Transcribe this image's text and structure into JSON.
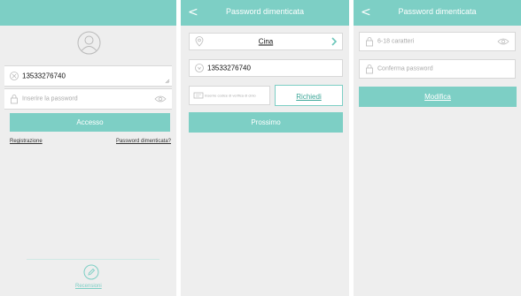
{
  "panel1": {
    "phone_value": "13533276740",
    "password_placeholder": "Inserire la password",
    "login_label": "Accesso",
    "register_label": "Registrazione",
    "forgot_label": "Password dimenticata?",
    "reviews_label": "Recensioni"
  },
  "panel2": {
    "title": "Password dimenticata",
    "back_label": "<",
    "country_value": "Cina",
    "phone_value": "13533276740",
    "code_placeholder": "Inserire codice di verifica di cinio",
    "request_label": "Richiedi",
    "next_label": "Prossimo"
  },
  "panel3": {
    "title": "Password dimenticata",
    "back_label": "<",
    "new_password_placeholder": "6-18 caratteri",
    "confirm_placeholder": "Conferma password",
    "modify_label": "Modifica"
  },
  "colors": {
    "accent": "#7dcfc5",
    "background": "#eeeeee",
    "field": "#ffffff"
  },
  "icons": [
    "user-avatar-icon",
    "clear-icon",
    "lock-icon",
    "eye-icon",
    "location-icon",
    "chevron-right-icon",
    "phone-icon",
    "message-icon",
    "pencil-icon"
  ]
}
